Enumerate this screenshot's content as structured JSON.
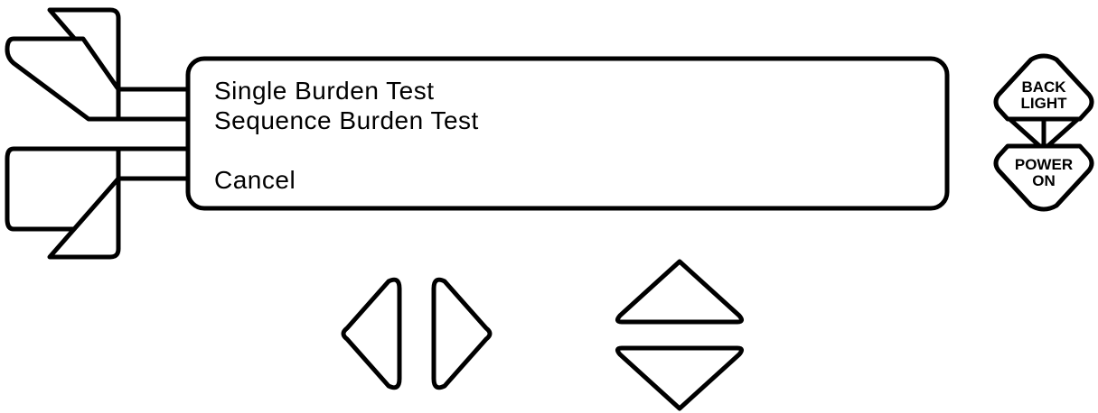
{
  "display": {
    "lines": [
      {
        "text": "Single Burden Test"
      },
      {
        "text": "Sequence Burden Test"
      },
      {
        "text": ""
      },
      {
        "text": "Cancel"
      }
    ]
  },
  "buttons": {
    "backlight": {
      "line1": "BACK",
      "line2": "LIGHT"
    },
    "power": {
      "line1": "POWER",
      "line2": "ON"
    }
  }
}
